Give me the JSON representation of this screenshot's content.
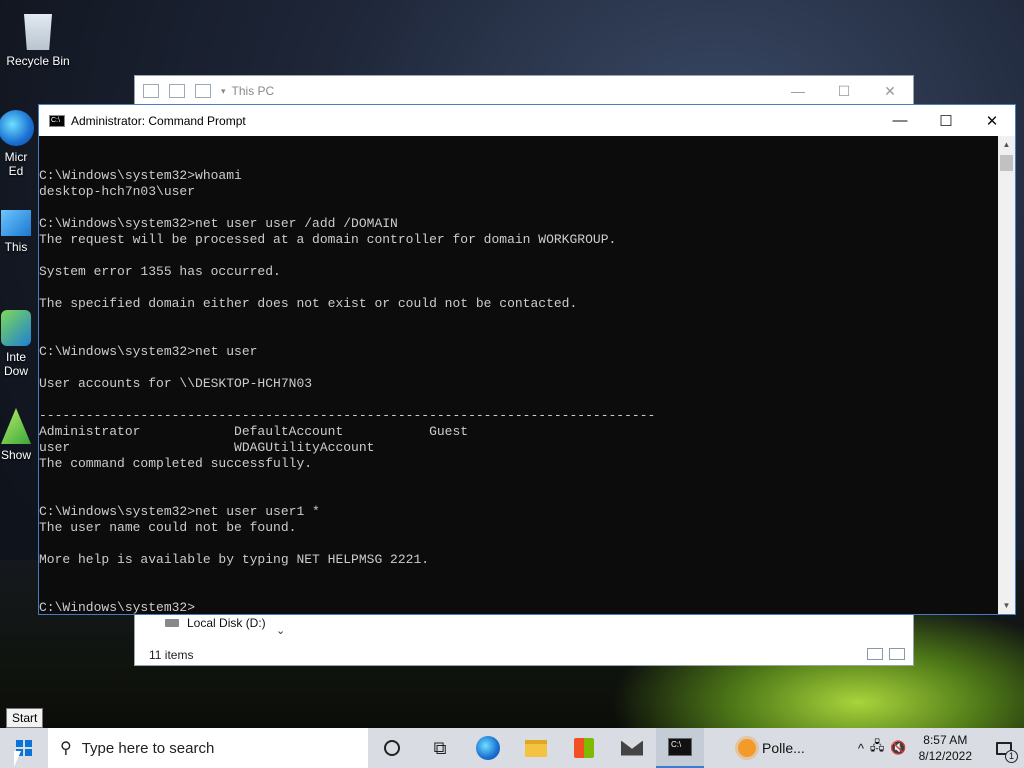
{
  "desktop": {
    "icons": [
      {
        "label": "Recycle Bin"
      },
      {
        "label": "Micr\nEd"
      },
      {
        "label": "This"
      },
      {
        "label": "Inte\nDow"
      },
      {
        "label": "Show"
      }
    ]
  },
  "explorer": {
    "title": "This PC",
    "local_disk": "Local Disk (D:)",
    "status": "11 items"
  },
  "cmd": {
    "title": "Administrator: Command Prompt",
    "lines": [
      "C:\\Windows\\system32>whoami",
      "desktop-hch7n03\\user",
      "",
      "C:\\Windows\\system32>net user user /add /DOMAIN",
      "The request will be processed at a domain controller for domain WORKGROUP.",
      "",
      "System error 1355 has occurred.",
      "",
      "The specified domain either does not exist or could not be contacted.",
      "",
      "",
      "C:\\Windows\\system32>net user",
      "",
      "User accounts for \\\\DESKTOP-HCH7N03",
      "",
      "-------------------------------------------------------------------------------",
      "Administrator            DefaultAccount           Guest",
      "user                     WDAGUtilityAccount",
      "The command completed successfully.",
      "",
      "",
      "C:\\Windows\\system32>net user user1 *",
      "The user name could not be found.",
      "",
      "More help is available by typing NET HELPMSG 2221.",
      "",
      "",
      "C:\\Windows\\system32>"
    ]
  },
  "tooltip": "Start",
  "taskbar": {
    "search_placeholder": "Type here to search",
    "weather_label": "Polle...",
    "time": "8:57 AM",
    "date": "8/12/2022",
    "notification_count": "1"
  }
}
